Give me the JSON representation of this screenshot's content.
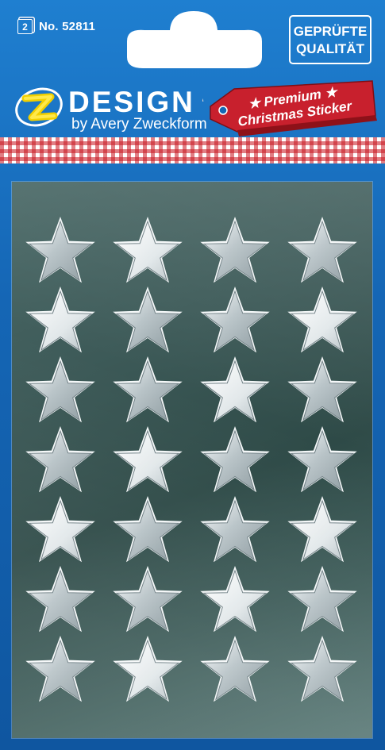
{
  "header": {
    "sticker_count": "2",
    "item_number": "No. 52811",
    "quality_line1": "GEPRÜFTE",
    "quality_line2": "QUALITÄT"
  },
  "logo": {
    "brand": "DESIGN",
    "byline": "by Avery Zweckform",
    "mark_letter": "Z"
  },
  "tag": {
    "line1": "★ Premium ★",
    "line2": "Christmas Sticker"
  },
  "colors": {
    "pack_blue": "#1566b5",
    "tag_red": "#c8202d",
    "sheet_green": "#3d5a58",
    "star_silver": "#c9d3d6"
  },
  "sheet": {
    "rows": 7,
    "columns": 4,
    "sticker_icon": "star-icon"
  }
}
